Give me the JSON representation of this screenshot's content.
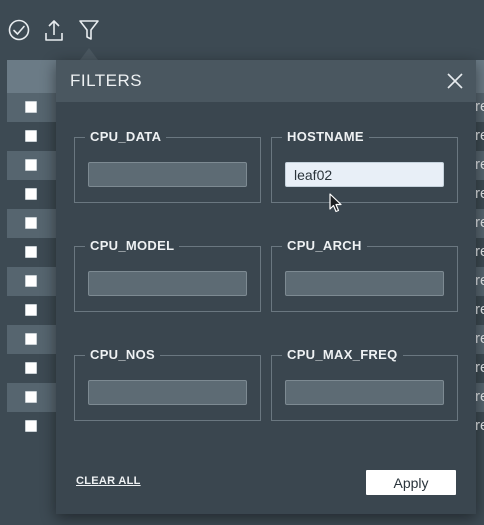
{
  "toolbar": {
    "icons": [
      "check-circle-icon",
      "upload-icon",
      "filter-icon"
    ]
  },
  "table": {
    "row_count": 12,
    "row_edge_text": "re"
  },
  "filters": {
    "title": "FILTERS",
    "fields": [
      {
        "label": "CPU_DATA",
        "value": "",
        "placeholder": ""
      },
      {
        "label": "HOSTNAME",
        "value": "leaf02",
        "placeholder": ""
      },
      {
        "label": "CPU_MODEL",
        "value": "",
        "placeholder": ""
      },
      {
        "label": "CPU_ARCH",
        "value": "",
        "placeholder": ""
      },
      {
        "label": "CPU_NOS",
        "value": "",
        "placeholder": ""
      },
      {
        "label": "CPU_MAX_FREQ",
        "value": "",
        "placeholder": ""
      }
    ],
    "clear_all_label": "CLEAR ALL",
    "apply_label": "Apply"
  },
  "colors": {
    "background": "#3d4a53",
    "modal": "#3a464f",
    "modal_header": "#4a5760",
    "input": "#5d6b74",
    "active_input": "#e8eff7"
  }
}
